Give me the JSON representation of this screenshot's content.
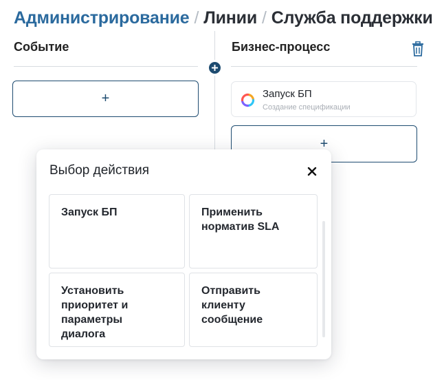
{
  "breadcrumb": {
    "root": "Администрирование",
    "separator": "/",
    "level2": "Линии",
    "current": "Служба поддержки"
  },
  "columns": {
    "event": {
      "title": "Событие",
      "add_label": "+"
    },
    "process": {
      "title": "Бизнес-процесс",
      "add_label": "+",
      "delete_icon": "trash-icon",
      "card": {
        "title": "Запуск БП",
        "subtitle": "Создание спецификации",
        "icon": "bp-logo-icon"
      }
    }
  },
  "connector": {
    "icon": "plus-icon"
  },
  "modal": {
    "title": "Выбор действия",
    "close_icon": "close-icon",
    "options": [
      {
        "label": "Запуск БП"
      },
      {
        "label": "Применить\nнорматив SLA"
      },
      {
        "label": "Установить\nприоритет и\nпараметры\nдиалога"
      },
      {
        "label": "Отправить\nклиенту\nсообщение"
      }
    ]
  },
  "colors": {
    "accent": "#1d4b70",
    "link": "#2b6a9e",
    "trash": "#2b6a9e",
    "border": "#d7dbe0"
  }
}
